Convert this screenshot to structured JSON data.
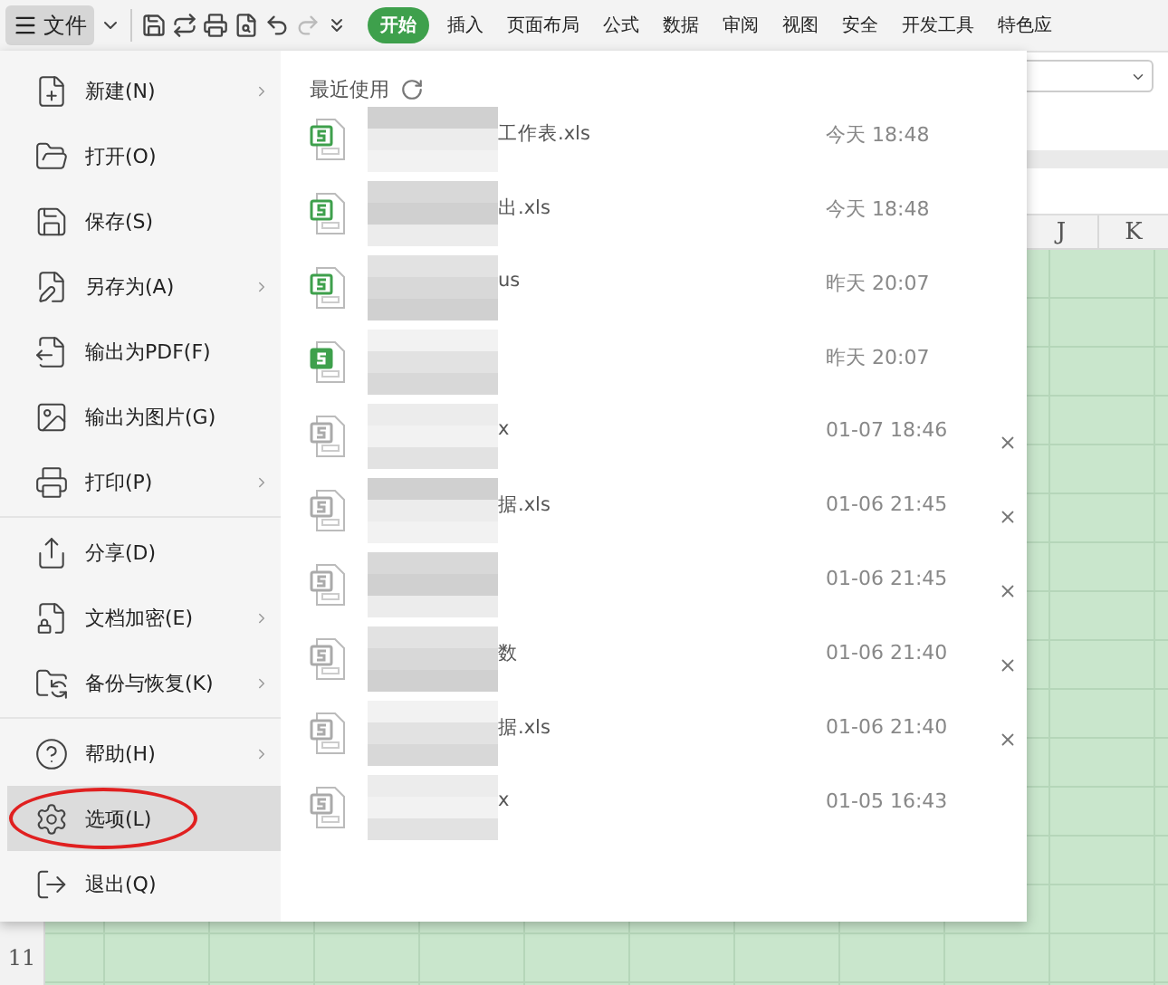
{
  "toolbar": {
    "file_menu": "文件",
    "tabs": [
      {
        "label": "开始",
        "selected": true
      },
      {
        "label": "插入",
        "selected": false
      },
      {
        "label": "页面布局",
        "selected": false
      },
      {
        "label": "公式",
        "selected": false
      },
      {
        "label": "数据",
        "selected": false
      },
      {
        "label": "审阅",
        "selected": false
      },
      {
        "label": "视图",
        "selected": false
      },
      {
        "label": "安全",
        "selected": false
      },
      {
        "label": "开发工具",
        "selected": false
      },
      {
        "label": "特色应",
        "selected": false
      }
    ]
  },
  "sheet": {
    "columns": [
      "J",
      "K"
    ],
    "row_number": "11"
  },
  "menu": {
    "groups": [
      [
        {
          "label": "新建(N)",
          "submenu": true,
          "selected": false
        },
        {
          "label": "打开(O)",
          "submenu": false,
          "selected": false
        },
        {
          "label": "保存(S)",
          "submenu": false,
          "selected": false
        },
        {
          "label": "另存为(A)",
          "submenu": true,
          "selected": false
        },
        {
          "label": "输出为PDF(F)",
          "submenu": false,
          "selected": false
        },
        {
          "label": "输出为图片(G)",
          "submenu": false,
          "selected": false
        },
        {
          "label": "打印(P)",
          "submenu": true,
          "selected": false
        }
      ],
      [
        {
          "label": "分享(D)",
          "submenu": false,
          "selected": false
        },
        {
          "label": "文档加密(E)",
          "submenu": true,
          "selected": false
        },
        {
          "label": "备份与恢复(K)",
          "submenu": true,
          "selected": false
        }
      ],
      [
        {
          "label": "帮助(H)",
          "submenu": true,
          "selected": false
        },
        {
          "label": "选项(L)",
          "submenu": false,
          "selected": true,
          "circled": true
        },
        {
          "label": "退出(Q)",
          "submenu": false,
          "selected": false
        }
      ]
    ]
  },
  "recent": {
    "title": "最近使用",
    "files": [
      {
        "name": "工作表.xls",
        "time": "今天 18:48",
        "kind": "green",
        "removable": false
      },
      {
        "name": "出.xls",
        "time": "今天 18:48",
        "kind": "green",
        "removable": false
      },
      {
        "name": "us",
        "time": "昨天 20:07",
        "kind": "green",
        "removable": false
      },
      {
        "time": "昨天 20:07",
        "kind": "solid",
        "removable": false
      },
      {
        "name": "x",
        "time": "01-07 18:46",
        "kind": "grey",
        "removable": true
      },
      {
        "name": "据.xls",
        "time": "01-06 21:45",
        "kind": "grey",
        "removable": true
      },
      {
        "time": "01-06 21:45",
        "kind": "grey",
        "removable": true
      },
      {
        "name": "数",
        "time": "01-06 21:40",
        "kind": "grey",
        "removable": true
      },
      {
        "name": "据.xls",
        "time": "01-06 21:40",
        "kind": "grey",
        "removable": true
      },
      {
        "name": "x",
        "time": "01-05 16:43",
        "kind": "grey",
        "removable": false
      }
    ]
  }
}
